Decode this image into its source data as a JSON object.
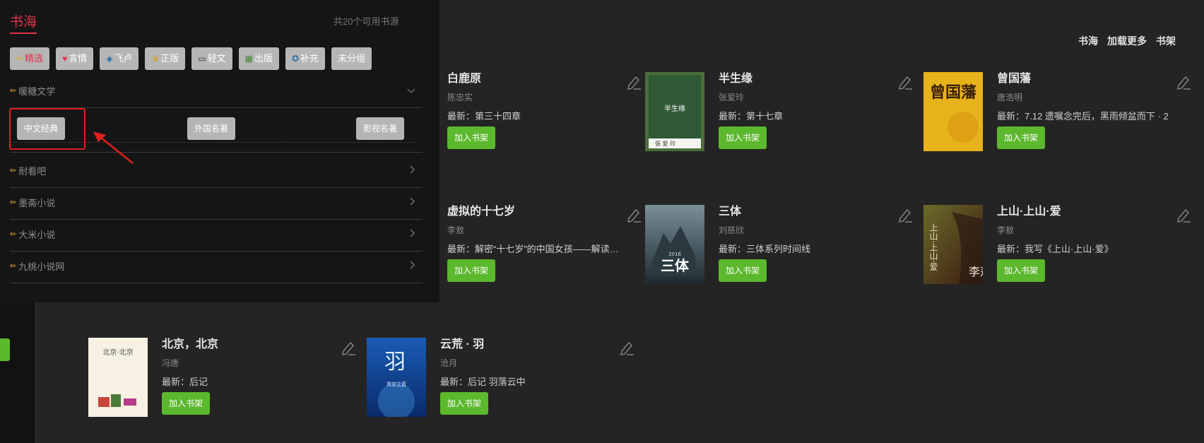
{
  "topnav": [
    "书海",
    "加载更多",
    "书架"
  ],
  "panel": {
    "title": "书海",
    "count": "共20个可用书源",
    "groups": [
      {
        "icon": "✏",
        "label": "精选",
        "active": true
      },
      {
        "icon": "♥",
        "label": "言情"
      },
      {
        "icon": "◈",
        "label": "飞卢"
      },
      {
        "icon": "♛",
        "label": "正版"
      },
      {
        "icon": "▭",
        "label": "轻文"
      },
      {
        "icon": "▦",
        "label": "出版"
      },
      {
        "icon": "✪",
        "label": "补充"
      },
      {
        "label": "未分组"
      }
    ],
    "expanded_source": "暖糖文学",
    "categories": [
      "中文经典",
      "外国名著",
      "影视名著"
    ],
    "sources": [
      "耐看吧",
      "墨斋小说",
      "大米小说",
      "九桃小说网"
    ]
  },
  "books": [
    {
      "title": "白鹿原",
      "author": "陈忠实",
      "latest": "最新：第三十四章",
      "add": "加入书架",
      "cover": "none"
    },
    {
      "title": "半生缘",
      "author": "张爱玲",
      "latest": "最新：第十七章",
      "add": "加入书架",
      "cover": "green",
      "cover_text": "半生缘"
    },
    {
      "title": "曾国藩",
      "author": "唐浩明",
      "latest": "最新：7.12 遗嘱念完后，黑雨倾盆而下 · 2",
      "add": "加入书架",
      "cover": "yellow",
      "cover_text": "曾国藩"
    },
    {
      "title": "虚拟的十七岁",
      "author": "李敖",
      "latest": "最新：解密“十七岁”的中国女孩——解读《十七岁》",
      "add": "加入书架",
      "cover": "none"
    },
    {
      "title": "三体",
      "author": "刘慈欣",
      "latest": "最新：三体系列时间线",
      "add": "加入书架",
      "cover": "santi",
      "cover_text": "三体"
    },
    {
      "title": "上山·上山·爱",
      "author": "李敖",
      "latest": "最新：我写《上山·上山·爱》",
      "add": "加入书架",
      "cover": "brown",
      "cover_text": "上山·上山·爱"
    },
    {
      "title": "北京，北京",
      "author": "冯唐",
      "latest": "最新：后记",
      "add": "加入书架",
      "cover": "cream",
      "cover_text": "北京·北京"
    },
    {
      "title": "云荒 · 羽",
      "author": "沧月",
      "latest": "最新：后记 羽落云中",
      "add": "加入书架",
      "cover": "blue",
      "cover_text": "羽"
    }
  ],
  "colors": {
    "accent": "#e0334a",
    "green": "#5cb82d",
    "panel_bg": "#151515",
    "content_bg": "#242424"
  }
}
